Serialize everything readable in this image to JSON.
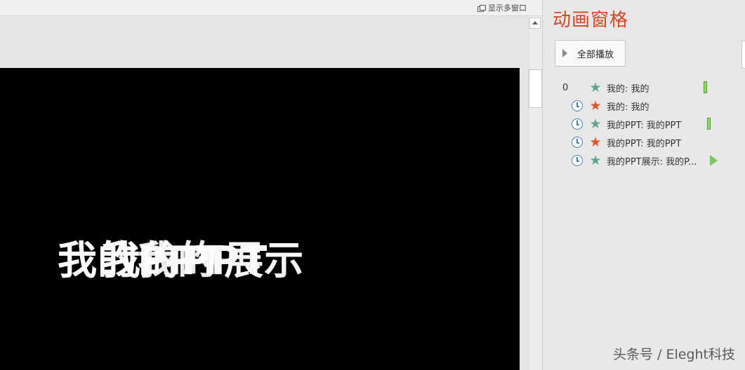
{
  "editor": {
    "multi_window_label": "显示多窗口",
    "slide_texts": [
      "我的PPT展示",
      "我的PPT",
      "我的我的"
    ]
  },
  "pane": {
    "title": "动画窗格",
    "play_all_label": "全部播放",
    "items": [
      {
        "index": "0",
        "trigger": "none",
        "star": "green",
        "label": "我的: 我的",
        "marker": "bar"
      },
      {
        "index": "",
        "trigger": "clock",
        "star": "red",
        "label": "我的: 我的",
        "marker": ""
      },
      {
        "index": "",
        "trigger": "clock",
        "star": "green",
        "label": "我的PPT: 我的PPT",
        "marker": "bar"
      },
      {
        "index": "",
        "trigger": "clock",
        "star": "red",
        "label": "我的PPT: 我的PPT",
        "marker": ""
      },
      {
        "index": "",
        "trigger": "clock",
        "star": "green",
        "label": "我的PPT展示: 我的P...",
        "marker": "triangle"
      }
    ]
  },
  "watermark": "头条号 / Eleght科技",
  "colors": {
    "title_accent": "#d24726",
    "star_green": "#5fa68d",
    "star_red": "#e0552a",
    "timeline_green": "#8fdc6f",
    "clock_blue": "#4a7bb7"
  }
}
